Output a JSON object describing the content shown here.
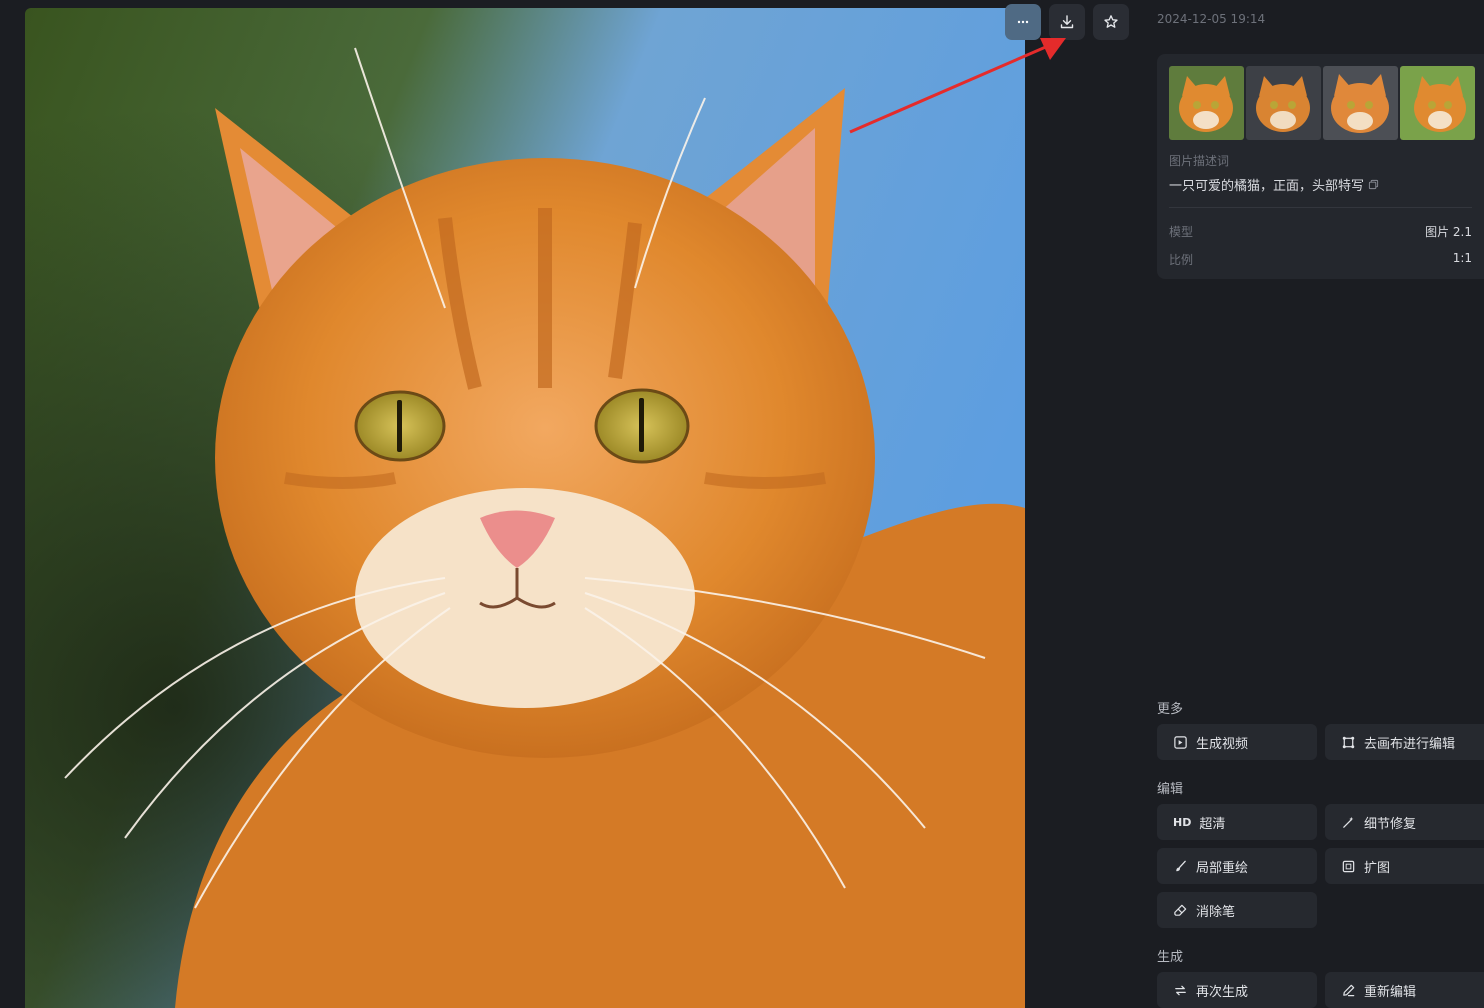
{
  "timestamp": "2024-12-05 19:14",
  "toolbar": {
    "more_icon": "more-horizontal-icon",
    "download_icon": "download-icon",
    "favorite_icon": "star-icon"
  },
  "info": {
    "desc_label": "图片描述词",
    "desc_text": "一只可爱的橘猫，正面，头部特写",
    "meta": [
      {
        "key": "模型",
        "value": "图片 2.1"
      },
      {
        "key": "比例",
        "value": "1:1"
      }
    ]
  },
  "sections": {
    "more": {
      "title": "更多",
      "buttons": [
        {
          "label": "生成视频",
          "icon": "video-add-icon"
        },
        {
          "label": "去画布进行编辑",
          "icon": "canvas-crop-icon"
        }
      ]
    },
    "edit": {
      "title": "编辑",
      "buttons": [
        {
          "label": "超清",
          "badge": "HD"
        },
        {
          "label": "细节修复",
          "icon": "magic-wand-icon"
        },
        {
          "label": "局部重绘",
          "icon": "brush-icon"
        },
        {
          "label": "扩图",
          "icon": "expand-icon"
        },
        {
          "label": "消除笔",
          "icon": "eraser-icon"
        }
      ]
    },
    "generate": {
      "title": "生成",
      "buttons": [
        {
          "label": "再次生成",
          "icon": "regenerate-icon"
        },
        {
          "label": "重新编辑",
          "icon": "pencil-icon"
        }
      ]
    }
  },
  "colors": {
    "background": "#1b1d22",
    "card": "#24272d",
    "button": "#26292f",
    "accent_more": "#4f6a84",
    "annotation_arrow": "#e52b2b"
  }
}
